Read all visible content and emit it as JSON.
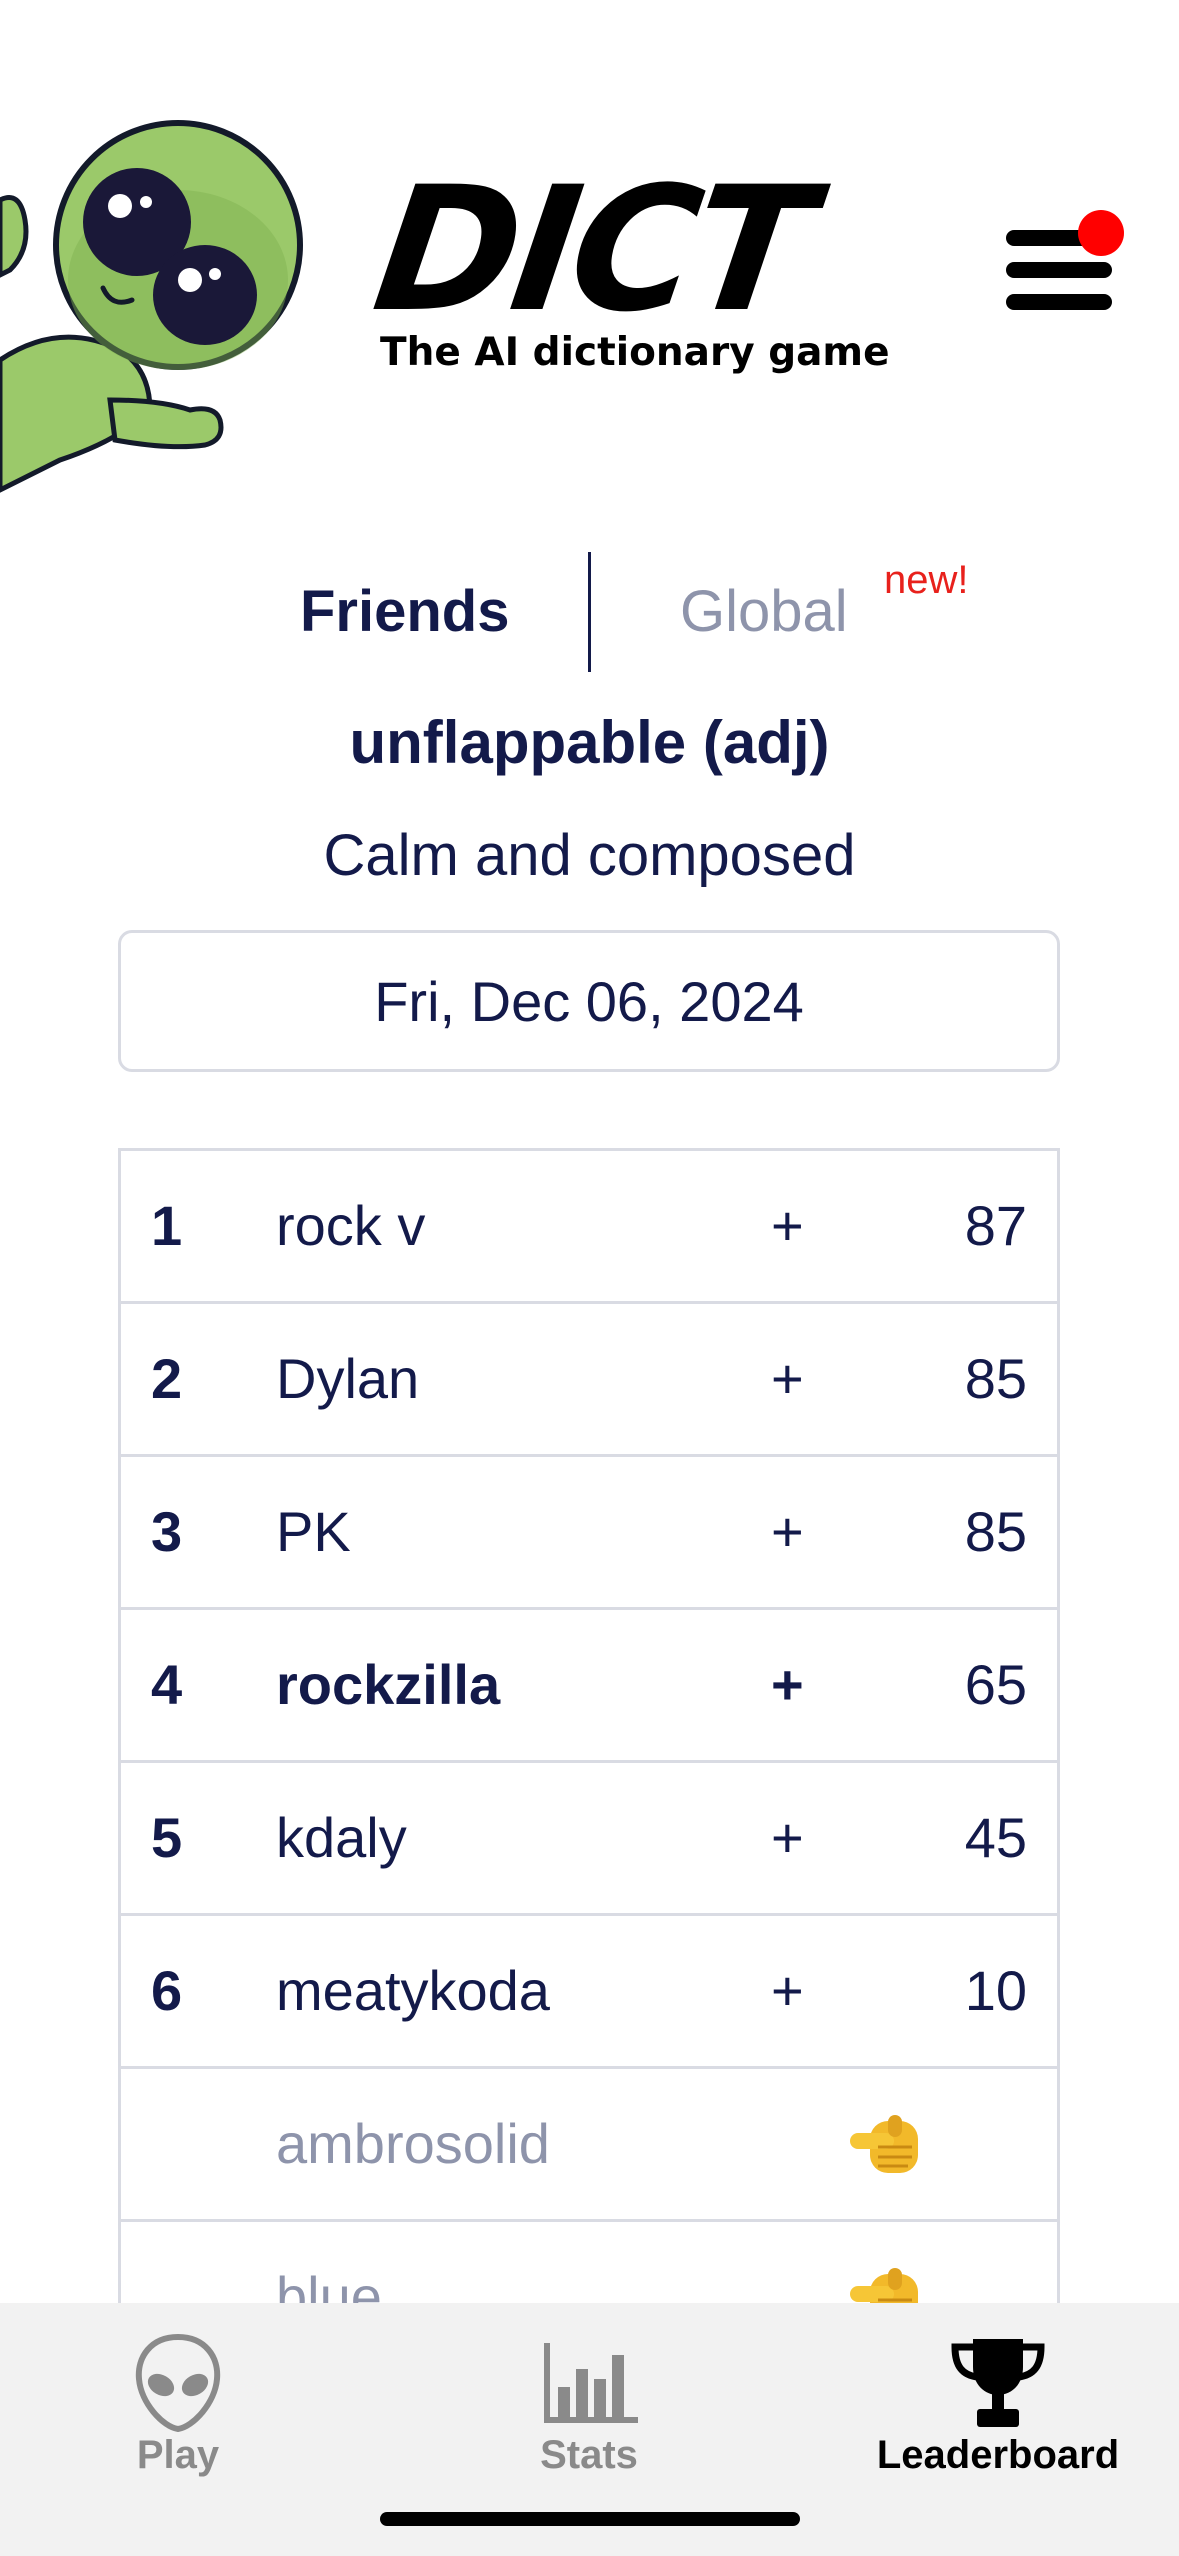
{
  "header": {
    "logo_title": "DICT",
    "logo_subtitle": "The AI dictionary game",
    "menu_icon": "hamburger-menu-icon",
    "notification_color": "#ff0000"
  },
  "tabs": {
    "friends": "Friends",
    "global": "Global",
    "global_badge": "new!"
  },
  "puzzle": {
    "word": "unflappable (adj)",
    "definition": "Calm and composed",
    "date": "Fri, Dec 06, 2024"
  },
  "leaderboard": {
    "rows": [
      {
        "rank": "1",
        "name": "rock v",
        "plus": "+",
        "score": "87"
      },
      {
        "rank": "2",
        "name": "Dylan",
        "plus": "+",
        "score": "85"
      },
      {
        "rank": "3",
        "name": "PK",
        "plus": "+",
        "score": "85"
      },
      {
        "rank": "4",
        "name": "rockzilla",
        "plus": "+",
        "score": "65"
      },
      {
        "rank": "5",
        "name": "kdaly",
        "plus": "+",
        "score": "45"
      },
      {
        "rank": "6",
        "name": "meatykoda",
        "plus": "+",
        "score": "10"
      }
    ],
    "pending": [
      {
        "name": "ambrosolid",
        "icon": "pointing-finger-icon"
      },
      {
        "name": "blue",
        "icon": "pointing-finger-icon"
      }
    ]
  },
  "nav": {
    "play": "Play",
    "stats": "Stats",
    "leaderboard": "Leaderboard",
    "active": "leaderboard"
  },
  "colors": {
    "primary_text": "#131a4a",
    "muted_text": "#8e94ab",
    "badge_red": "#e8211c",
    "mascot_green": "#9bc96a"
  }
}
